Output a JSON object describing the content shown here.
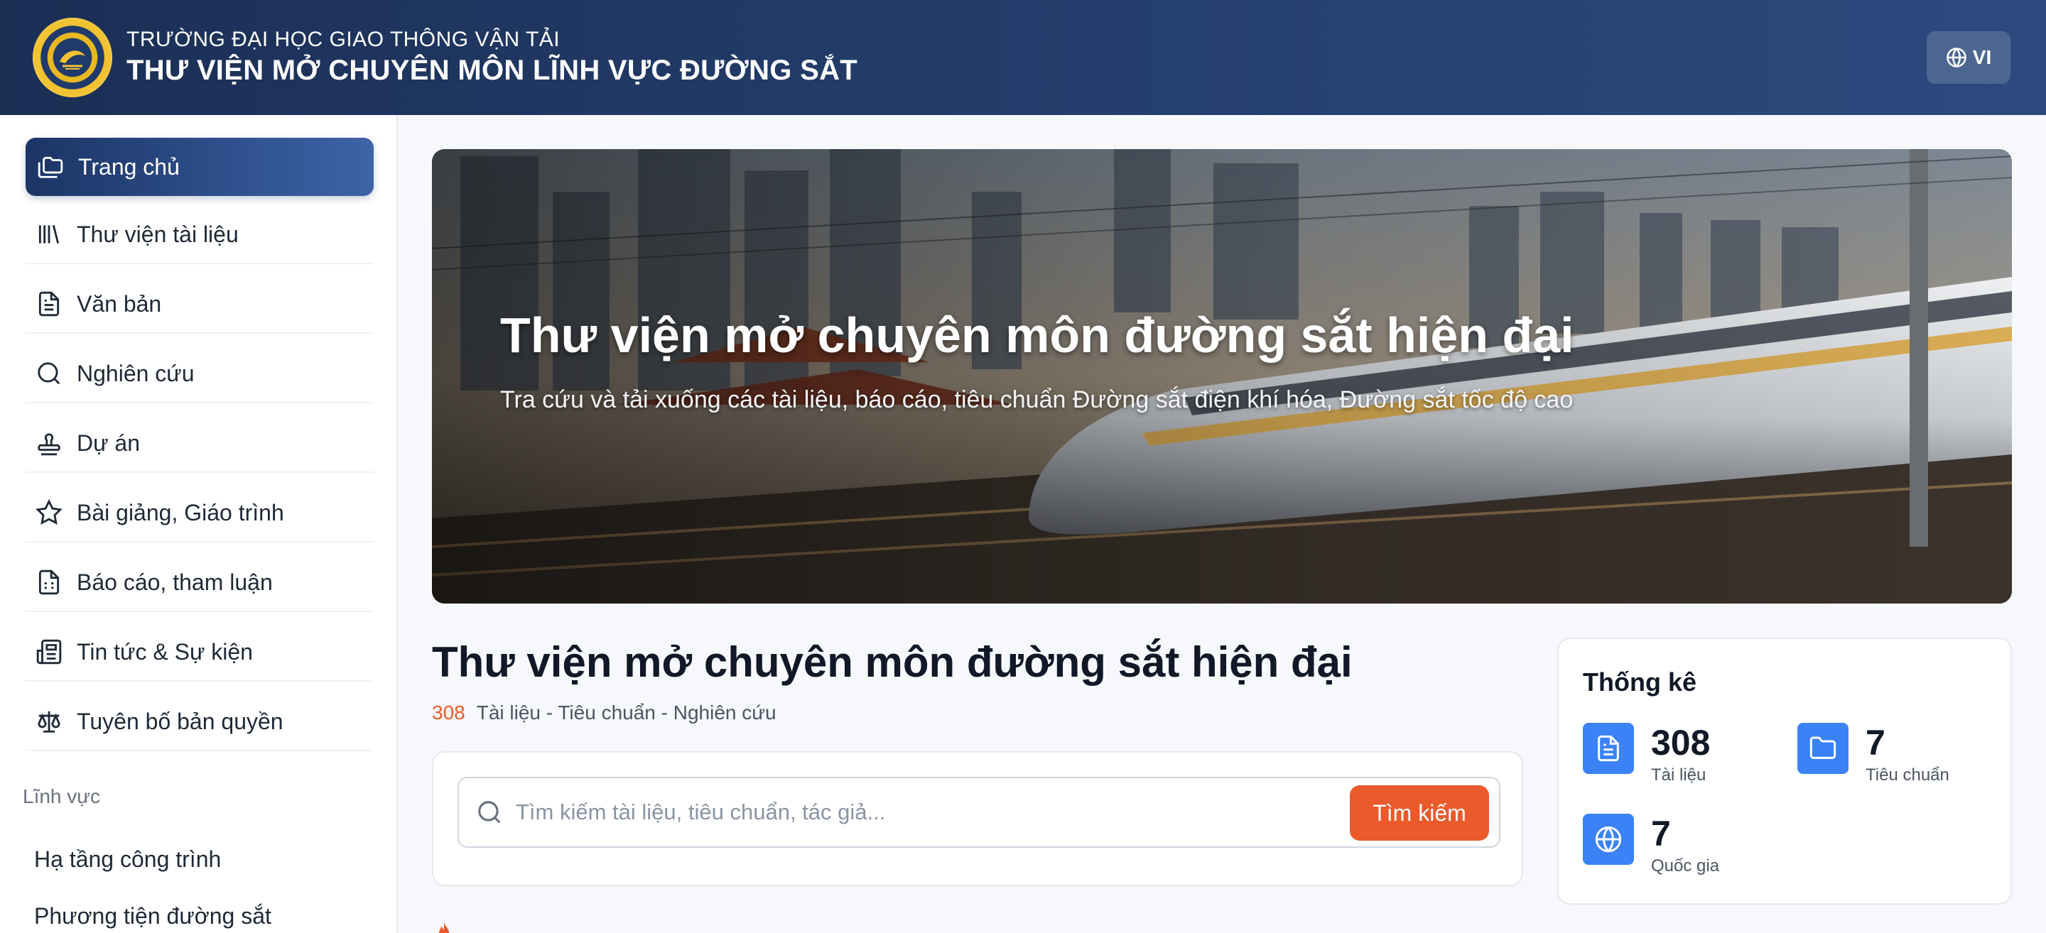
{
  "header": {
    "subtitle": "TRƯỜNG ĐẠI HỌC GIAO THÔNG VẬN TẢI",
    "title": "THƯ VIỆN MỞ CHUYÊN MÔN LĨNH VỰC ĐƯỜNG SẮT",
    "language": "VI"
  },
  "sidebar": {
    "items": [
      {
        "label": "Trang chủ",
        "icon": "folders-icon",
        "active": true
      },
      {
        "label": "Thư viện tài liệu",
        "icon": "library-icon"
      },
      {
        "label": "Văn bản",
        "icon": "file-text-icon"
      },
      {
        "label": "Nghiên cứu",
        "icon": "search-icon"
      },
      {
        "label": "Dự án",
        "icon": "stamp-icon"
      },
      {
        "label": "Bài giảng, Giáo trình",
        "icon": "star-icon"
      },
      {
        "label": "Báo cáo, tham luận",
        "icon": "file-spreadsheet-icon"
      },
      {
        "label": "Tin tức & Sự kiện",
        "icon": "newspaper-icon"
      },
      {
        "label": "Tuyên bố bản quyền",
        "icon": "scale-icon"
      }
    ],
    "section_label": "Lĩnh vực",
    "sub_items": [
      "Hạ tầng công trình",
      "Phương tiện đường sắt"
    ]
  },
  "hero": {
    "title": "Thư viện mở chuyên môn đường sắt hiện đại",
    "subtitle": "Tra cứu và tải xuống các tài liệu, báo cáo, tiêu chuẩn Đường sắt điện khí hóa, Đường sắt tốc độ cao"
  },
  "main": {
    "title": "Thư viện mở chuyên môn đường sắt hiện đại",
    "count": "308",
    "count_label": "Tài liệu - Tiêu chuẩn - Nghiên cứu",
    "search_placeholder": "Tìm kiếm tài liệu, tiêu chuẩn, tác giả...",
    "search_button": "Tìm kiếm"
  },
  "stats": {
    "title": "Thống kê",
    "items": [
      {
        "value": "308",
        "label": "Tài liệu",
        "icon": "document-icon"
      },
      {
        "value": "7",
        "label": "Tiêu chuẩn",
        "icon": "folder-icon"
      },
      {
        "value": "7",
        "label": "Quốc gia",
        "icon": "globe-icon"
      }
    ]
  },
  "colors": {
    "header": "#1b2f55",
    "accent_orange": "#ea5a2b",
    "stat_blue": "#3b82f6"
  }
}
